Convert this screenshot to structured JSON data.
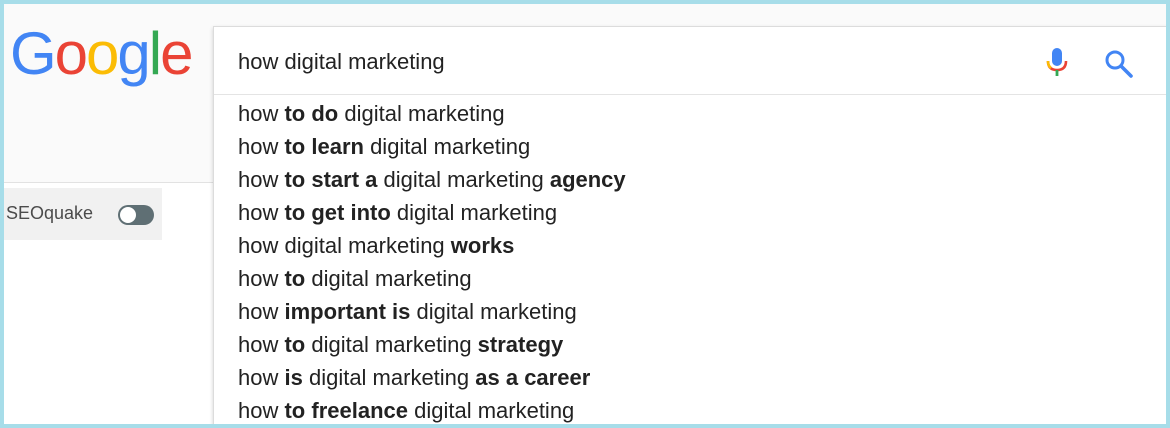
{
  "logo": {
    "letters": [
      "G",
      "o",
      "o",
      "g",
      "l",
      "e"
    ],
    "colors": [
      "#4285f4",
      "#ea4335",
      "#fbbc05",
      "#4285f4",
      "#34a853",
      "#ea4335"
    ]
  },
  "search": {
    "query": "how digital marketing"
  },
  "icons": {
    "mic": "microphone-icon",
    "search": "search-icon"
  },
  "seoquake": {
    "label": "SEOquake",
    "toggle_state": "off"
  },
  "suggestions": [
    [
      {
        "t": "how "
      },
      {
        "t": "to do",
        "b": true
      },
      {
        "t": " digital marketing"
      }
    ],
    [
      {
        "t": "how "
      },
      {
        "t": "to learn",
        "b": true
      },
      {
        "t": " digital marketing"
      }
    ],
    [
      {
        "t": "how "
      },
      {
        "t": "to start a",
        "b": true
      },
      {
        "t": " digital marketing "
      },
      {
        "t": "agency",
        "b": true
      }
    ],
    [
      {
        "t": "how "
      },
      {
        "t": "to get into",
        "b": true
      },
      {
        "t": " digital marketing"
      }
    ],
    [
      {
        "t": "how digital marketing "
      },
      {
        "t": "works",
        "b": true
      }
    ],
    [
      {
        "t": "how "
      },
      {
        "t": "to",
        "b": true
      },
      {
        "t": " digital marketing"
      }
    ],
    [
      {
        "t": "how "
      },
      {
        "t": "important is",
        "b": true
      },
      {
        "t": " digital marketing"
      }
    ],
    [
      {
        "t": "how "
      },
      {
        "t": "to",
        "b": true
      },
      {
        "t": " digital marketing "
      },
      {
        "t": "strategy",
        "b": true
      }
    ],
    [
      {
        "t": "how "
      },
      {
        "t": "is",
        "b": true
      },
      {
        "t": " digital marketing "
      },
      {
        "t": "as a career",
        "b": true
      }
    ],
    [
      {
        "t": "how "
      },
      {
        "t": "to freelance",
        "b": true
      },
      {
        "t": " digital marketing"
      }
    ]
  ]
}
